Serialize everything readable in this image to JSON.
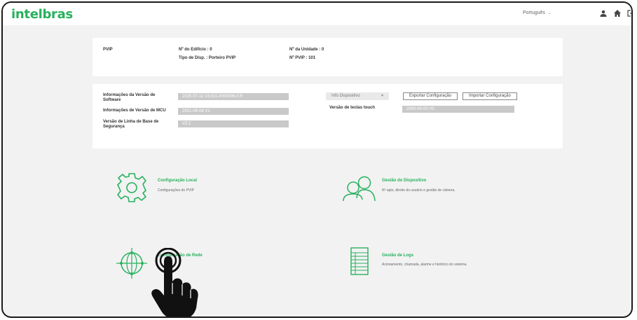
{
  "header": {
    "logo": "intelbras",
    "language": "Português",
    "icons": [
      "user-icon",
      "home-icon",
      "logout-icon"
    ]
  },
  "device_card": {
    "type_label": "PVIP",
    "building": "Nº do Edifício : 0",
    "device_type": "Tipo de Disp. : Porteiro PVIP",
    "unit": "Nº da Unidade : 0",
    "pvip_no": "Nº PVIP : 101"
  },
  "version_card": {
    "software_label": "Informações da Versão de Software",
    "software_value": "2025-07-11 V4.511.0000006.0.R",
    "mcu_label": "Informações de Versão de MCU",
    "mcu_value": "2021-09-08 V1",
    "security_label": "Versão de Linha de Base de Segurança",
    "security_value": "V2.1",
    "info_select": "Info Dispositivo",
    "export_button": "Exportar Configuração",
    "import_button": "Importar Configuração",
    "touch_label": "Versão de teclas touch",
    "touch_value": "2000-00-00 V0"
  },
  "tiles": {
    "local_config": {
      "title": "Configuração Local",
      "desc": "Configurações do PVIP"
    },
    "device_mgmt": {
      "title": "Gestão do Dispositivo",
      "desc": "Nº apto, direito do usuário e gestão de câmera."
    },
    "network_config": {
      "title": "Configuração de Rede",
      "desc": ""
    },
    "log_mgmt": {
      "title": "Gestão de Logs",
      "desc": "Acionamento, chamada, alarme e histórico do sistema."
    }
  },
  "colors": {
    "brand": "#27b15d",
    "field": "#c9c9c9",
    "background": "#f2f2f2"
  }
}
